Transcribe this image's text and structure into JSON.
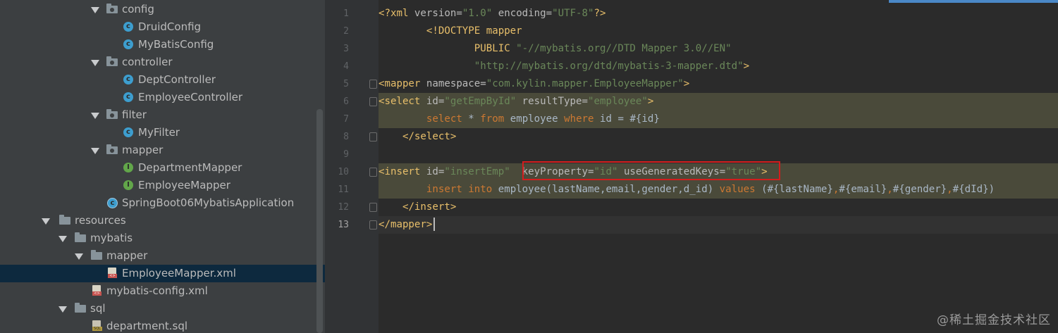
{
  "project_tree": [
    {
      "label": "config",
      "type": "package",
      "expanded": true
    },
    {
      "label": "DruidConfig",
      "type": "class"
    },
    {
      "label": "MyBatisConfig",
      "type": "class"
    },
    {
      "label": "controller",
      "type": "package",
      "expanded": true
    },
    {
      "label": "DeptController",
      "type": "class"
    },
    {
      "label": "EmployeeController",
      "type": "class"
    },
    {
      "label": "filter",
      "type": "package",
      "expanded": true
    },
    {
      "label": "MyFilter",
      "type": "class"
    },
    {
      "label": "mapper",
      "type": "package",
      "expanded": true
    },
    {
      "label": "DepartmentMapper",
      "type": "interface"
    },
    {
      "label": "EmployeeMapper",
      "type": "interface"
    },
    {
      "label": "SpringBoot06MybatisApplication",
      "type": "spring-class"
    },
    {
      "label": "resources",
      "type": "folder",
      "expanded": true
    },
    {
      "label": "mybatis",
      "type": "folder",
      "expanded": true
    },
    {
      "label": "mapper",
      "type": "folder",
      "expanded": true
    },
    {
      "label": "EmployeeMapper.xml",
      "type": "xml",
      "selected": true
    },
    {
      "label": "mybatis-config.xml",
      "type": "xml"
    },
    {
      "label": "sql",
      "type": "folder",
      "expanded": true
    },
    {
      "label": "department.sql",
      "type": "sql"
    }
  ],
  "editor": {
    "current_line": 13,
    "lines": [
      {
        "n": "1",
        "tokens": [
          [
            "tag",
            "<?xml "
          ],
          [
            "attr",
            "version="
          ],
          [
            "val",
            "\"1.0\" "
          ],
          [
            "attr",
            "encoding="
          ],
          [
            "val",
            "\"UTF-8\""
          ],
          [
            "tag",
            "?>"
          ]
        ]
      },
      {
        "n": "2",
        "tokens": [
          [
            "txt",
            "        "
          ],
          [
            "tag",
            "<!DOCTYPE mapper"
          ]
        ]
      },
      {
        "n": "3",
        "tokens": [
          [
            "txt",
            "                "
          ],
          [
            "tag",
            "PUBLIC "
          ],
          [
            "val",
            "\"-//mybatis.org//DTD Mapper 3.0//EN\""
          ]
        ]
      },
      {
        "n": "4",
        "tokens": [
          [
            "txt",
            "                "
          ],
          [
            "val",
            "\"http://mybatis.org/dtd/mybatis-3-mapper.dtd\""
          ],
          [
            "tag",
            ">"
          ]
        ]
      },
      {
        "n": "5",
        "tokens": [
          [
            "tag",
            "<mapper"
          ],
          [
            "attr",
            " namespace="
          ],
          [
            "val",
            "\"com.kylin.mapper.EmployeeMapper\""
          ],
          [
            "tag",
            ">"
          ]
        ]
      },
      {
        "n": "6",
        "tokens": [
          [
            "tag",
            "<select"
          ],
          [
            "attr",
            " id="
          ],
          [
            "val",
            "\"getEmpById\""
          ],
          [
            "attr",
            " resultType="
          ],
          [
            "val",
            "\"employee\""
          ],
          [
            "tag",
            ">"
          ]
        ]
      },
      {
        "n": "7",
        "tokens": [
          [
            "txt",
            "        "
          ],
          [
            "kw",
            "select"
          ],
          [
            "txt",
            " * "
          ],
          [
            "kw",
            "from"
          ],
          [
            "txt",
            " employee "
          ],
          [
            "kw",
            "where"
          ],
          [
            "txt",
            " id = #{id}"
          ]
        ]
      },
      {
        "n": "8",
        "tokens": [
          [
            "txt",
            "    "
          ],
          [
            "tag",
            "</select>"
          ]
        ]
      },
      {
        "n": "9",
        "tokens": []
      },
      {
        "n": "10",
        "tokens": [
          [
            "tag",
            "<insert"
          ],
          [
            "attr",
            " id="
          ],
          [
            "val",
            "\"insertEmp\""
          ],
          [
            "attr",
            "  keyProperty="
          ],
          [
            "val",
            "\"id\""
          ],
          [
            "attr",
            " useGeneratedKeys="
          ],
          [
            "val",
            "\"true\""
          ],
          [
            "tag",
            ">"
          ]
        ]
      },
      {
        "n": "11",
        "tokens": [
          [
            "txt",
            "        "
          ],
          [
            "kw",
            "insert into"
          ],
          [
            "txt",
            " employee(lastName,email,gender,d_id) "
          ],
          [
            "kw",
            "values"
          ],
          [
            "txt",
            " (#{lastName}"
          ],
          [
            "kw",
            ","
          ],
          [
            "txt",
            "#{email}"
          ],
          [
            "kw",
            ","
          ],
          [
            "txt",
            "#{gender}"
          ],
          [
            "kw",
            ","
          ],
          [
            "txt",
            "#{dId})"
          ]
        ]
      },
      {
        "n": "12",
        "tokens": [
          [
            "txt",
            "    "
          ],
          [
            "tag",
            "</insert>"
          ]
        ]
      },
      {
        "n": "13",
        "tokens": [
          [
            "tag",
            "</mapper>"
          ]
        ]
      }
    ]
  },
  "highlight_note_keys": "keyProperty useGeneratedKeys",
  "watermark": "@稀土掘金技术社区"
}
